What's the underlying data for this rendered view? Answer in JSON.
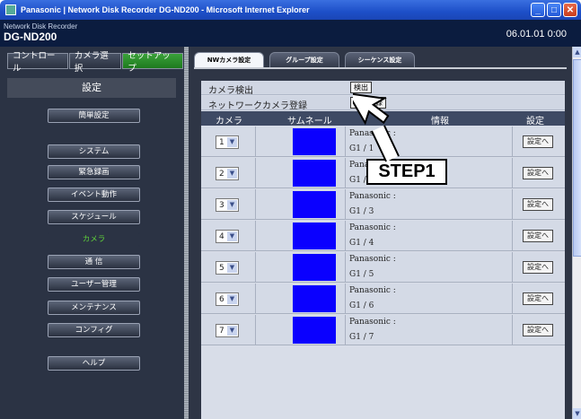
{
  "window": {
    "title": "Panasonic | Network Disk Recorder DG-ND200 - Microsoft Internet Explorer",
    "min_icon": "minimize-icon",
    "max_icon": "maximize-icon",
    "close_icon": "close-icon"
  },
  "header": {
    "subtitle": "Network Disk Recorder",
    "model": "DG-ND200",
    "datetime": "06.01.01  0:00"
  },
  "topnav": {
    "control": "コントロール",
    "camera_select": "カメラ選択",
    "setup": "セットアップ"
  },
  "sidebar": {
    "heading": "設定",
    "items": [
      {
        "label": "簡単設定"
      },
      {
        "label": "システム"
      },
      {
        "label": "緊急録画"
      },
      {
        "label": "イベント動作"
      },
      {
        "label": "スケジュール"
      },
      {
        "label": "カメラ"
      },
      {
        "label": "通 信"
      },
      {
        "label": "ユーザー管理"
      },
      {
        "label": "メンテナンス"
      },
      {
        "label": "コンフィグ"
      },
      {
        "label": "ヘルプ"
      }
    ]
  },
  "tabs": [
    {
      "label": "NWカメラ設定"
    },
    {
      "label": "グループ設定"
    },
    {
      "label": "シーケンス設定"
    }
  ],
  "camera_detect": {
    "label": "カメラ検出",
    "button": "検出"
  },
  "nw_register": {
    "label": "ネットワークカメラ登録",
    "button": "一括登録"
  },
  "columns": {
    "camera": "カメラ",
    "thumbnail": "サムネール",
    "info": "情報",
    "settings": "設定"
  },
  "rows": [
    {
      "camera": "1",
      "info1": "Panasonic :",
      "info2": "G1 / 1",
      "btn": "設定へ"
    },
    {
      "camera": "2",
      "info1": "Panasonic :",
      "info2": "G1 / 2",
      "btn": "設定へ"
    },
    {
      "camera": "3",
      "info1": "Panasonic :",
      "info2": "G1 / 3",
      "btn": "設定へ"
    },
    {
      "camera": "4",
      "info1": "Panasonic :",
      "info2": "G1 / 4",
      "btn": "設定へ"
    },
    {
      "camera": "5",
      "info1": "Panasonic :",
      "info2": "G1 / 5",
      "btn": "設定へ"
    },
    {
      "camera": "6",
      "info1": "Panasonic :",
      "info2": "G1 / 6",
      "btn": "設定へ"
    },
    {
      "camera": "7",
      "info1": "Panasonic :",
      "info2": "G1 / 7",
      "btn": "設定へ"
    }
  ],
  "annotation": {
    "step": "STEP1"
  },
  "colors": {
    "thumbnail": "#0a00ff",
    "accent_green": "#5fd13a",
    "header_bg": "#0b1c3f"
  }
}
